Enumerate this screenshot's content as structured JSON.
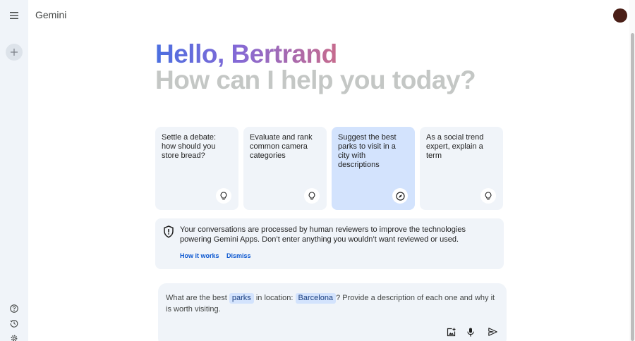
{
  "header": {
    "brand": "Gemini"
  },
  "greeting": {
    "hello": "Hello, Bertrand",
    "subtitle": "How can I help you today?"
  },
  "cards": [
    {
      "text": "Settle a debate: how should you store bread?",
      "icon": "lightbulb-icon",
      "selected": false
    },
    {
      "text": "Evaluate and rank common camera categories",
      "icon": "lightbulb-icon",
      "selected": false
    },
    {
      "text": "Suggest the best parks to visit in a city with descriptions",
      "icon": "compass-icon",
      "selected": true
    },
    {
      "text": "As a social trend expert, explain a term",
      "icon": "lightbulb-icon",
      "selected": false
    }
  ],
  "notice": {
    "text": "Your conversations are processed by human reviewers to improve the technologies powering Gemini Apps. Don’t enter anything you wouldn’t want reviewed or used.",
    "how_it_works": "How it works",
    "dismiss": "Dismiss"
  },
  "prompt": {
    "part1": "What are the best",
    "chip1": "parks",
    "part2": "in location:",
    "chip2": "Barcelona",
    "part3": "? Provide a description of each one and why it is worth visiting."
  },
  "sidebar": {
    "icons": [
      "menu-icon",
      "plus-icon",
      "help-icon",
      "history-icon",
      "settings-icon"
    ]
  },
  "colors": {
    "rail_bg": "#f0f4f9",
    "card_bg": "#f0f4f9",
    "card_selected_bg": "#d3e3fd",
    "link": "#0b57d0",
    "greeting_gradient": [
      "#4b6fe0",
      "#8469d6",
      "#c76b8d"
    ],
    "greeting_sub": "#c4c7c5",
    "avatar": "#4a1f17"
  }
}
